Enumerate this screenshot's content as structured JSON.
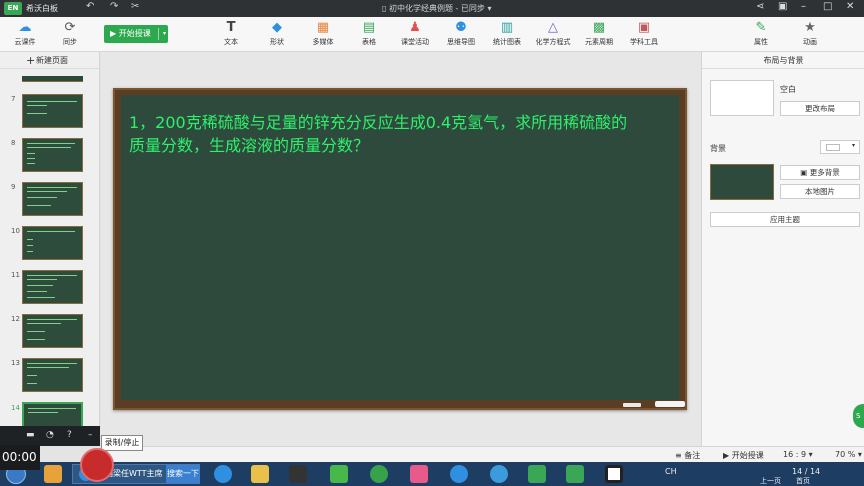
{
  "app": {
    "name": "希沃白板",
    "logo": "EN",
    "document": "初中化学经典例题 - 已同步"
  },
  "toolbar": {
    "cloud": "云课件",
    "sync": "同步",
    "start_teaching": "开始授课",
    "tools": [
      "文本",
      "形状",
      "多媒体",
      "表格",
      "课堂活动",
      "思维导图",
      "统计图表",
      "化学方程式",
      "元素周期",
      "学科工具"
    ],
    "properties": "属性",
    "animation": "动画"
  },
  "sidebar": {
    "new_page": "新建页面",
    "pages": [
      7,
      8,
      9,
      10,
      11,
      12,
      13,
      14
    ],
    "active_page": 14
  },
  "slide": {
    "text": "1，200克稀硫酸与足量的锌充分反应生成0.4克氢气，求所用稀硫酸的质量分数，生成溶液的质量分数？"
  },
  "right_panel": {
    "title": "布局与背景",
    "layout_label": "空白",
    "change_layout": "更改布局",
    "background_label": "背景",
    "more_backgrounds": "更多背景",
    "local_image": "本地图片",
    "apply_theme": "应用主题"
  },
  "statusbar": {
    "notes": "备注",
    "start_teaching": "开始授课",
    "ratio": "16 : 9",
    "page_counter": "14 / 14",
    "zoom": "70 %",
    "prev_page": "上一页",
    "first_page": "首页"
  },
  "recorder": {
    "timer": "00:00",
    "tooltip": "录制/停止"
  },
  "taskbar": {
    "task_title": "刘国梁任WTT主席",
    "search": "搜索一下",
    "lang": "CH"
  },
  "colors": {
    "accent": "#2ea84f",
    "board": "#2d4a3c",
    "chalk_text": "#2ef06b"
  }
}
